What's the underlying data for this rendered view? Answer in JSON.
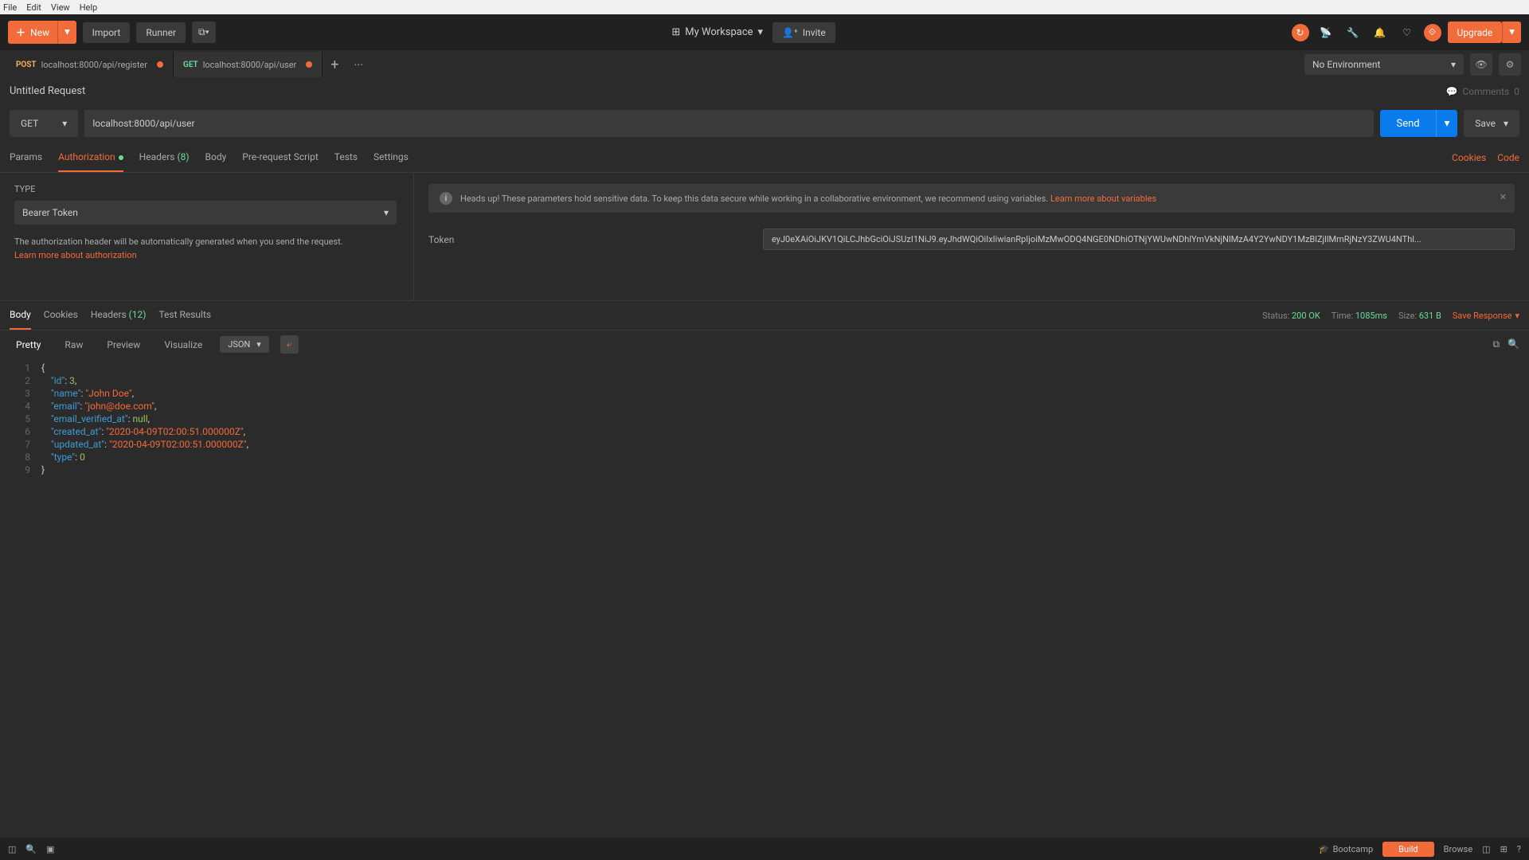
{
  "menubar": [
    "File",
    "Edit",
    "View",
    "Help"
  ],
  "toolbar": {
    "new": "New",
    "import": "Import",
    "runner": "Runner",
    "workspace": "My Workspace",
    "invite": "Invite",
    "upgrade": "Upgrade"
  },
  "tabs": [
    {
      "method": "POST",
      "label": "localhost:8000/api/register",
      "dirty": true
    },
    {
      "method": "GET",
      "label": "localhost:8000/api/user",
      "dirty": true,
      "active": true
    }
  ],
  "environment": "No Environment",
  "request": {
    "title": "Untitled Request",
    "comments_label": "Comments",
    "comments_count": "0",
    "method": "GET",
    "url": "localhost:8000/api/user",
    "send": "Send",
    "save": "Save"
  },
  "req_tabs": {
    "params": "Params",
    "authorization": "Authorization",
    "headers": "Headers",
    "headers_count": "(8)",
    "body": "Body",
    "prerequest": "Pre-request Script",
    "tests": "Tests",
    "settings": "Settings",
    "cookies": "Cookies",
    "code": "Code"
  },
  "auth": {
    "type_label": "TYPE",
    "type_value": "Bearer Token",
    "note": "The authorization header will be automatically generated when you send the request.",
    "learn": "Learn more about authorization",
    "banner": "Heads up! These parameters hold sensitive data. To keep this data secure while working in a collaborative environment, we recommend using variables.",
    "banner_link": "Learn more about variables",
    "token_label": "Token",
    "token_value": "eyJ0eXAiOiJKV1QiLCJhbGciOiJSUzI1NiJ9.eyJhdWQiOiIxIiwianRpIjoiMzMwODQ4NGE0NDhiOTNjYWUwNDhlYmVkNjNlMzA4Y2YwNDY1MzBlZjllMmRjNzY3ZWU4NThl..."
  },
  "resp_tabs": {
    "body": "Body",
    "cookies": "Cookies",
    "headers": "Headers",
    "headers_count": "(12)",
    "tests": "Test Results"
  },
  "resp_meta": {
    "status_lbl": "Status:",
    "status_val": "200 OK",
    "time_lbl": "Time:",
    "time_val": "1085ms",
    "size_lbl": "Size:",
    "size_val": "631 B",
    "save": "Save Response"
  },
  "view": {
    "pretty": "Pretty",
    "raw": "Raw",
    "preview": "Preview",
    "visualize": "Visualize",
    "format": "JSON"
  },
  "response_json": [
    "{",
    "    \"id\": 3,",
    "    \"name\": \"John Doe\",",
    "    \"email\": \"john@doe.com\",",
    "    \"email_verified_at\": null,",
    "    \"created_at\": \"2020-04-09T02:00:51.000000Z\",",
    "    \"updated_at\": \"2020-04-09T02:00:51.000000Z\",",
    "    \"type\": 0",
    "}"
  ],
  "statusbar": {
    "bootcamp": "Bootcamp",
    "build": "Build",
    "browse": "Browse"
  }
}
